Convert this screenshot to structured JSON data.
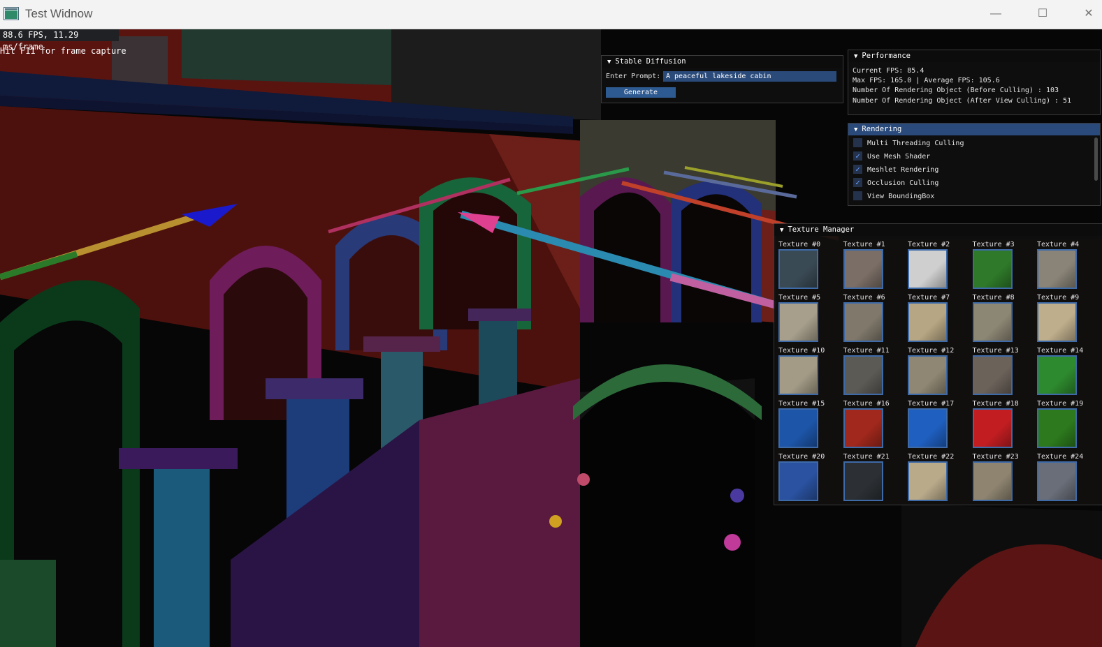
{
  "window": {
    "title": "Test Widnow",
    "minimize_glyph": "—",
    "maximize_glyph": "☐",
    "close_glyph": "✕"
  },
  "overlay": {
    "fps": "88.6 FPS, 11.29 ms/frame",
    "hint": "Hit F11 for frame capture"
  },
  "stable_diffusion": {
    "title": "Stable Diffusion",
    "prompt_label": "Enter Prompt:",
    "prompt_value": "A peaceful lakeside cabin",
    "generate_label": "Generate"
  },
  "performance": {
    "title": "Performance",
    "lines": [
      "Current FPS: 85.4",
      "Max FPS: 165.0 | Average FPS: 105.6",
      "Number Of Rendering Object (Before Culling) : 103",
      "Number Of Rendering Object (After View Culling) : 51"
    ]
  },
  "rendering": {
    "title": "Rendering",
    "options": [
      {
        "label": "Multi Threading Culling",
        "checked": false
      },
      {
        "label": "Use Mesh Shader",
        "checked": true
      },
      {
        "label": "Meshlet Rendering",
        "checked": true
      },
      {
        "label": "Occlusion Culling",
        "checked": true
      },
      {
        "label": "View BoundingBox",
        "checked": false
      }
    ]
  },
  "texture_manager": {
    "title": "Texture Manager",
    "textures": [
      {
        "label": "Texture #0",
        "color": "#3a4a55"
      },
      {
        "label": "Texture #1",
        "color": "#7a6e66"
      },
      {
        "label": "Texture #2",
        "color": "#cfcfcf"
      },
      {
        "label": "Texture #3",
        "color": "#2f7a2a"
      },
      {
        "label": "Texture #4",
        "color": "#8a8478"
      },
      {
        "label": "Texture #5",
        "color": "#a79f8c"
      },
      {
        "label": "Texture #6",
        "color": "#7f786b"
      },
      {
        "label": "Texture #7",
        "color": "#b7a683"
      },
      {
        "label": "Texture #8",
        "color": "#8c8674"
      },
      {
        "label": "Texture #9",
        "color": "#bfae8c"
      },
      {
        "label": "Texture #10",
        "color": "#a39b86"
      },
      {
        "label": "Texture #11",
        "color": "#5b5a55"
      },
      {
        "label": "Texture #12",
        "color": "#8f8773"
      },
      {
        "label": "Texture #13",
        "color": "#6b625a"
      },
      {
        "label": "Texture #14",
        "color": "#2e8a2e"
      },
      {
        "label": "Texture #15",
        "color": "#1d55a8"
      },
      {
        "label": "Texture #16",
        "color": "#a0281c"
      },
      {
        "label": "Texture #17",
        "color": "#1f5fc0"
      },
      {
        "label": "Texture #18",
        "color": "#c21e22"
      },
      {
        "label": "Texture #19",
        "color": "#2d7a1e"
      },
      {
        "label": "Texture #20",
        "color": "#2a52a0"
      },
      {
        "label": "Texture #21",
        "color": "#2c3034"
      },
      {
        "label": "Texture #22",
        "color": "#b9aa8a"
      },
      {
        "label": "Texture #23",
        "color": "#8e8470"
      },
      {
        "label": "Texture #24",
        "color": "#6a6e78"
      }
    ]
  }
}
